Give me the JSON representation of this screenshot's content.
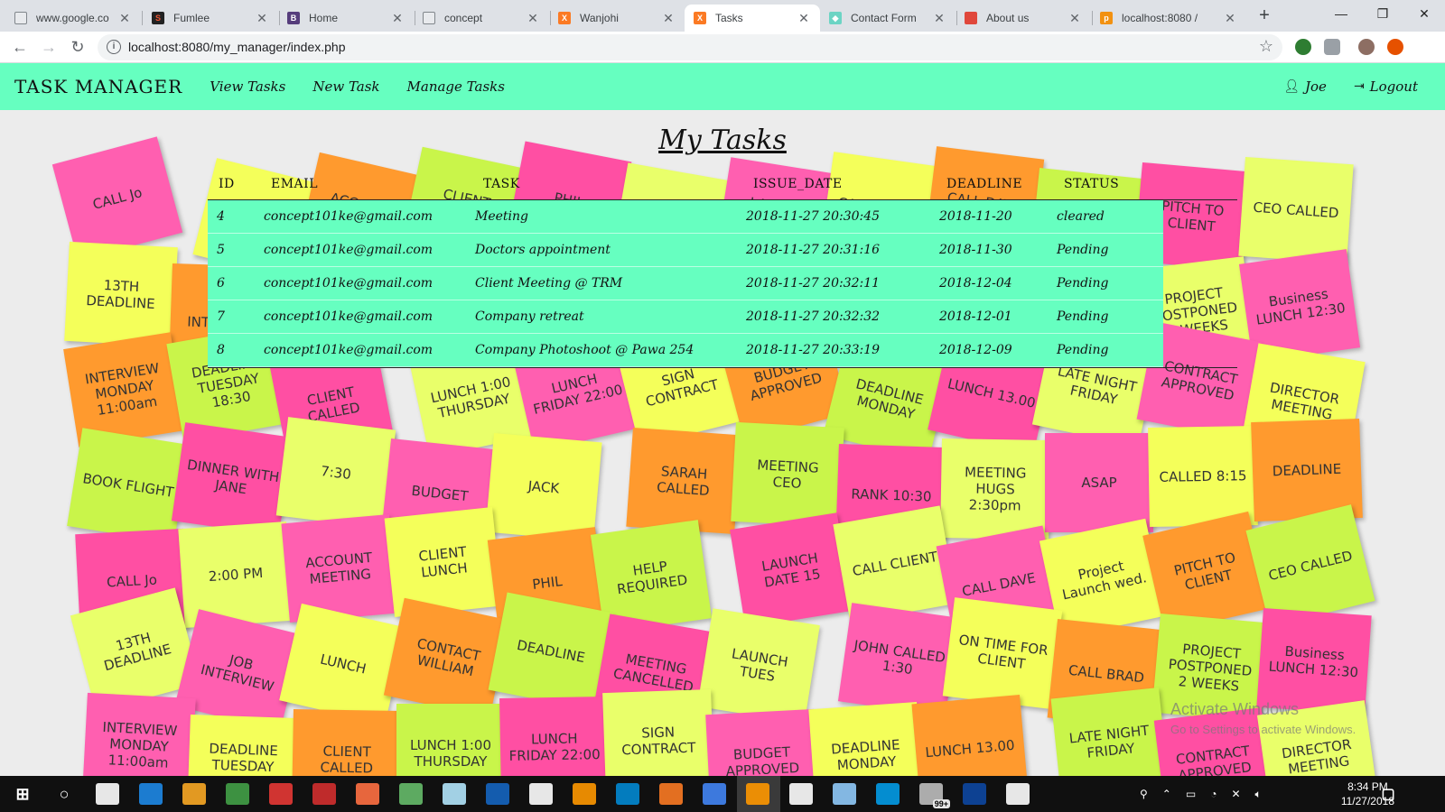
{
  "browser": {
    "tabs": [
      {
        "label": "www.google.co",
        "favicon": "document-icon",
        "active": false
      },
      {
        "label": "Fumlee",
        "favicon": "fumlee-icon",
        "active": false
      },
      {
        "label": "Home",
        "favicon": "bootstrap-icon",
        "active": false
      },
      {
        "label": "concept",
        "favicon": "document-icon",
        "active": false
      },
      {
        "label": "Wanjohi",
        "favicon": "xampp-icon",
        "active": false
      },
      {
        "label": "Tasks",
        "favicon": "xampp-icon",
        "active": true
      },
      {
        "label": "Contact Form",
        "favicon": "diamond-icon",
        "active": false
      },
      {
        "label": "About us",
        "favicon": "flag-icon",
        "active": false
      },
      {
        "label": "localhost:8080 /",
        "favicon": "phpmyadmin-icon",
        "active": false
      }
    ],
    "new_tab": "+",
    "window_controls": {
      "minimize": "—",
      "restore": "❐",
      "close": "✕"
    },
    "address": {
      "url": "localhost:8080/my_manager/index.php",
      "info": "i"
    }
  },
  "app": {
    "brand": "TASK MANAGER",
    "nav": [
      "View Tasks",
      "New Task",
      "Manage Tasks"
    ],
    "user": "Joe",
    "logout": "Logout",
    "accent": "#66ffc0"
  },
  "page": {
    "title": "My Tasks",
    "table": {
      "headers": [
        "ID",
        "EMAIL",
        "TASK",
        "ISSUE_DATE",
        "DEADLINE",
        "STATUS"
      ],
      "rows": [
        [
          "4",
          "concept101ke@gmail.com",
          "Meeting",
          "2018-11-27 20:30:45",
          "2018-11-20",
          "cleared"
        ],
        [
          "5",
          "concept101ke@gmail.com",
          "Doctors appointment",
          "2018-11-27 20:31:16",
          "2018-11-30",
          "Pending"
        ],
        [
          "6",
          "concept101ke@gmail.com",
          "Client Meeting @ TRM",
          "2018-11-27 20:32:11",
          "2018-12-04",
          "Pending"
        ],
        [
          "7",
          "concept101ke@gmail.com",
          "Company retreat",
          "2018-11-27 20:32:32",
          "2018-12-01",
          "Pending"
        ],
        [
          "8",
          "concept101ke@gmail.com",
          "Company Photoshoot @ Pawa 254",
          "2018-11-27 20:33:19",
          "2018-12-09",
          "Pending"
        ]
      ]
    }
  },
  "background_notes": [
    "CALL Jo",
    "2:00 PM",
    "ACCOUNT MEETING",
    "CLIENT LUNCH",
    "PHIL",
    "HELP REQUIRED",
    "LAUNCH DATE 15",
    "CALL CLIENT",
    "CALL DAVE",
    "Project Launch wed.",
    "PITCH TO CLIENT",
    "CEO CALLED",
    "13TH DEADLINE",
    "JOB INTERVIEW",
    "LUNCH",
    "CONTACT WILLIAM",
    "DEADLINE",
    "MEETING CANCELLED",
    "LAUNCH TUES",
    "JOHN CALLED 1:30",
    "ON TIME FOR CLIENT",
    "CALL BRAD",
    "PROJECT POSTPONED 2 WEEKS",
    "Business LUNCH 12:30",
    "INTERVIEW MONDAY 11:00am",
    "DEADLINE TUESDAY 18:30",
    "CLIENT CALLED",
    "LUNCH 1:00 THURSDAY",
    "LUNCH FRIDAY 22:00",
    "SIGN CONTRACT",
    "BUDGET APPROVED",
    "DEADLINE MONDAY",
    "LUNCH 13.00",
    "LATE NIGHT FRIDAY",
    "CONTRACT APPROVED",
    "DIRECTOR MEETING",
    "BOOK FLIGHT",
    "DINNER WITH JANE",
    "7:30",
    "BUDGET",
    "JACK",
    "SARAH CALLED",
    "MEETING CEO",
    "RANK 10:30",
    "MEETING HUGS 2:30pm",
    "ASAP",
    "CALLED 8:15",
    "DEADLINE"
  ],
  "watermark": {
    "line1": "Activate Windows",
    "line2": "Go to Settings to activate Windows."
  },
  "taskbar": {
    "apps": [
      "explorer-view-icon",
      "edge-icon",
      "file-explorer-icon",
      "store-icon",
      "app-icon",
      "acrobat-icon",
      "firefox-icon",
      "utorrent-icon",
      "notes-icon",
      "word-icon",
      "cards-icon",
      "vlc-icon",
      "telkom-icon",
      "xampp-icon",
      "chrome-icon",
      "sublime-icon",
      "obs-icon",
      "paint-icon",
      "edge-round-icon",
      "mail-badge-icon",
      "photoshop-icon",
      "photos-icon"
    ],
    "badge": "99+",
    "time": "8:34 PM",
    "date": "11/27/2018"
  }
}
